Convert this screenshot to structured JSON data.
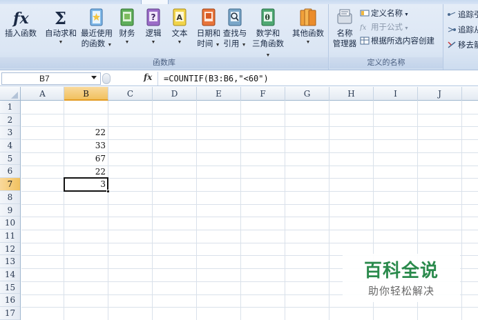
{
  "ribbon": {
    "function_library": {
      "label": "函数库",
      "buttons": [
        {
          "label": "插入函数",
          "icon": "insert-function-icon"
        },
        {
          "label": "自动求和",
          "icon": "sigma-icon"
        },
        {
          "label": "最近使用的函数",
          "icon": "recent-functions-icon"
        },
        {
          "label": "财务",
          "icon": "financial-book-icon"
        },
        {
          "label": "逻辑",
          "icon": "logical-book-icon"
        },
        {
          "label": "文本",
          "icon": "text-book-icon"
        },
        {
          "label": "日期和时间",
          "icon": "date-time-book-icon"
        },
        {
          "label": "查找与引用",
          "icon": "lookup-book-icon"
        },
        {
          "label": "数学和三角函数",
          "icon": "math-book-icon"
        },
        {
          "label": "其他函数",
          "icon": "more-functions-icon"
        }
      ],
      "two_line": {
        "recent_l1": "最近使用",
        "recent_l2": "的函数",
        "date_l1": "日期和",
        "date_l2": "时间",
        "lookup_l1": "查找与",
        "lookup_l2": "引用",
        "math_l1": "数学和",
        "math_l2": "三角函数"
      }
    },
    "defined_names": {
      "label": "定义的名称",
      "manager_l1": "名称",
      "manager_l2": "管理器",
      "define_name": "定义名称",
      "use_in_formula": "用于公式",
      "create_from_selection": "根据所选内容创建"
    },
    "auditing": {
      "trace_precedents": "追踪引",
      "trace_dependents": "追踪从",
      "remove_arrows": "移去箭"
    }
  },
  "formula_bar": {
    "name_box": "B7",
    "fx": "fx",
    "formula": "=COUNTIF(B3:B6,\"<60\")"
  },
  "grid": {
    "columns": [
      "A",
      "B",
      "C",
      "D",
      "E",
      "F",
      "G",
      "H",
      "I",
      "J"
    ],
    "rows": [
      "1",
      "2",
      "3",
      "4",
      "5",
      "6",
      "7",
      "8",
      "9",
      "10",
      "11",
      "12",
      "13",
      "14",
      "15",
      "16",
      "17"
    ],
    "active_column": "B",
    "active_row": "7",
    "cells": {
      "B3": "22",
      "B4": "33",
      "B5": "67",
      "B6": "22",
      "B7": "3"
    }
  },
  "watermark": {
    "title": "百科全说",
    "subtitle": "助你轻松解决"
  },
  "colors": {
    "ribbon_bg": "#dbe6f4",
    "header_active": "#f1c15f",
    "watermark_green": "#2a8a4c"
  }
}
